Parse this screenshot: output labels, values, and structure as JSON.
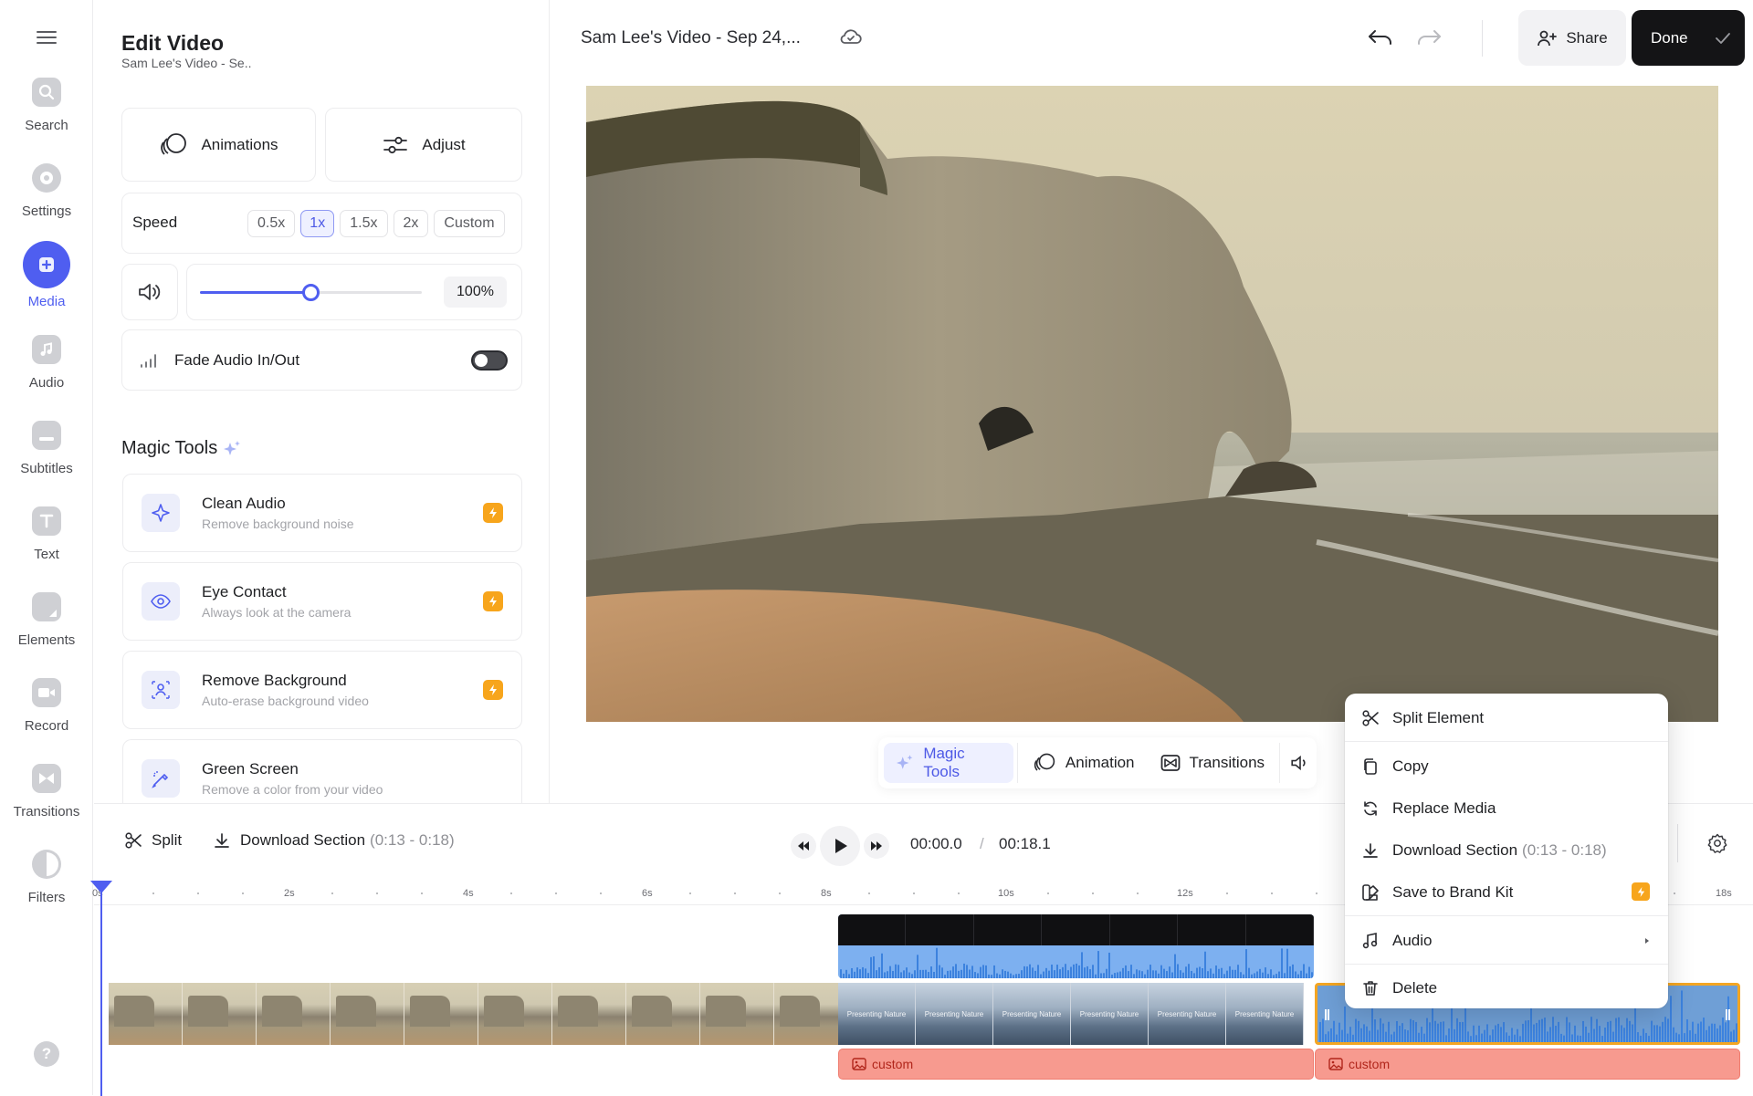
{
  "rail": {
    "items": [
      {
        "label": "Search",
        "icon": "search-icon"
      },
      {
        "label": "Settings",
        "icon": "settings-icon"
      },
      {
        "label": "Media",
        "icon": "plus-icon",
        "active": true
      },
      {
        "label": "Audio",
        "icon": "music-note-icon"
      },
      {
        "label": "Subtitles",
        "icon": "subtitles-icon"
      },
      {
        "label": "Text",
        "icon": "text-icon"
      },
      {
        "label": "Elements",
        "icon": "elements-icon"
      },
      {
        "label": "Record",
        "icon": "record-icon"
      },
      {
        "label": "Transitions",
        "icon": "transitions-icon"
      },
      {
        "label": "Filters",
        "icon": "filters-icon"
      }
    ],
    "help": "?"
  },
  "panel": {
    "title": "Edit Video",
    "subtitle": "Sam Lee's Video - Se..",
    "animations_label": "Animations",
    "adjust_label": "Adjust",
    "speed": {
      "label": "Speed",
      "options": [
        "0.5x",
        "1x",
        "1.5x",
        "2x",
        "Custom"
      ],
      "selected": "1x"
    },
    "volume": {
      "value": "100%",
      "level": 0.5
    },
    "fade": {
      "label": "Fade Audio In/Out",
      "enabled": false
    },
    "magic_tools": {
      "heading": "Magic Tools",
      "tools": [
        {
          "title": "Clean Audio",
          "subtitle": "Remove background noise"
        },
        {
          "title": "Eye Contact",
          "subtitle": "Always look at the camera"
        },
        {
          "title": "Remove Background",
          "subtitle": "Auto-erase background video"
        },
        {
          "title": "Green Screen",
          "subtitle": "Remove a color from your video"
        }
      ]
    }
  },
  "header": {
    "title": "Sam Lee's Video - Sep 24,...",
    "share_label": "Share",
    "done_label": "Done"
  },
  "video_toolbar": {
    "tabs": [
      "Magic Tools",
      "Animation",
      "Transitions"
    ],
    "active": "Magic Tools"
  },
  "timeline": {
    "split_label": "Split",
    "download_label": "Download Section",
    "download_range": "(0:13 - 0:18)",
    "current_time": "00:00.0",
    "separator": "/",
    "total_time": "00:18.1",
    "ticks": [
      "0s",
      "2s",
      "4s",
      "6s",
      "8s",
      "10s",
      "12s",
      "18s"
    ],
    "clip_caption": "Presenting Nature",
    "custom_labels": [
      "custom",
      "custom"
    ]
  },
  "context_menu": {
    "split": "Split Element",
    "copy": "Copy",
    "replace": "Replace Media",
    "download": "Download Section",
    "download_range": "(0:13 - 0:18)",
    "brand_kit": "Save to Brand Kit",
    "audio": "Audio",
    "delete": "Delete"
  },
  "colors": {
    "accent": "#4f5ef0",
    "bolt": "#f7a51c",
    "selection": "#f4a623",
    "waveform": "#7db0f0",
    "custom_track": "#f79a8f"
  }
}
